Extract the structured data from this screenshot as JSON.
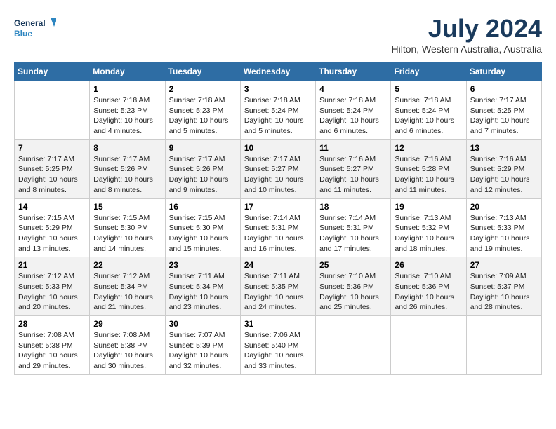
{
  "header": {
    "logo_line1": "General",
    "logo_line2": "Blue",
    "month": "July 2024",
    "location": "Hilton, Western Australia, Australia"
  },
  "days_of_week": [
    "Sunday",
    "Monday",
    "Tuesday",
    "Wednesday",
    "Thursday",
    "Friday",
    "Saturday"
  ],
  "weeks": [
    [
      {
        "day": "",
        "info": ""
      },
      {
        "day": "1",
        "info": "Sunrise: 7:18 AM\nSunset: 5:23 PM\nDaylight: 10 hours\nand 4 minutes."
      },
      {
        "day": "2",
        "info": "Sunrise: 7:18 AM\nSunset: 5:23 PM\nDaylight: 10 hours\nand 5 minutes."
      },
      {
        "day": "3",
        "info": "Sunrise: 7:18 AM\nSunset: 5:24 PM\nDaylight: 10 hours\nand 5 minutes."
      },
      {
        "day": "4",
        "info": "Sunrise: 7:18 AM\nSunset: 5:24 PM\nDaylight: 10 hours\nand 6 minutes."
      },
      {
        "day": "5",
        "info": "Sunrise: 7:18 AM\nSunset: 5:24 PM\nDaylight: 10 hours\nand 6 minutes."
      },
      {
        "day": "6",
        "info": "Sunrise: 7:17 AM\nSunset: 5:25 PM\nDaylight: 10 hours\nand 7 minutes."
      }
    ],
    [
      {
        "day": "7",
        "info": "Sunrise: 7:17 AM\nSunset: 5:25 PM\nDaylight: 10 hours\nand 8 minutes."
      },
      {
        "day": "8",
        "info": "Sunrise: 7:17 AM\nSunset: 5:26 PM\nDaylight: 10 hours\nand 8 minutes."
      },
      {
        "day": "9",
        "info": "Sunrise: 7:17 AM\nSunset: 5:26 PM\nDaylight: 10 hours\nand 9 minutes."
      },
      {
        "day": "10",
        "info": "Sunrise: 7:17 AM\nSunset: 5:27 PM\nDaylight: 10 hours\nand 10 minutes."
      },
      {
        "day": "11",
        "info": "Sunrise: 7:16 AM\nSunset: 5:27 PM\nDaylight: 10 hours\nand 11 minutes."
      },
      {
        "day": "12",
        "info": "Sunrise: 7:16 AM\nSunset: 5:28 PM\nDaylight: 10 hours\nand 11 minutes."
      },
      {
        "day": "13",
        "info": "Sunrise: 7:16 AM\nSunset: 5:29 PM\nDaylight: 10 hours\nand 12 minutes."
      }
    ],
    [
      {
        "day": "14",
        "info": "Sunrise: 7:15 AM\nSunset: 5:29 PM\nDaylight: 10 hours\nand 13 minutes."
      },
      {
        "day": "15",
        "info": "Sunrise: 7:15 AM\nSunset: 5:30 PM\nDaylight: 10 hours\nand 14 minutes."
      },
      {
        "day": "16",
        "info": "Sunrise: 7:15 AM\nSunset: 5:30 PM\nDaylight: 10 hours\nand 15 minutes."
      },
      {
        "day": "17",
        "info": "Sunrise: 7:14 AM\nSunset: 5:31 PM\nDaylight: 10 hours\nand 16 minutes."
      },
      {
        "day": "18",
        "info": "Sunrise: 7:14 AM\nSunset: 5:31 PM\nDaylight: 10 hours\nand 17 minutes."
      },
      {
        "day": "19",
        "info": "Sunrise: 7:13 AM\nSunset: 5:32 PM\nDaylight: 10 hours\nand 18 minutes."
      },
      {
        "day": "20",
        "info": "Sunrise: 7:13 AM\nSunset: 5:33 PM\nDaylight: 10 hours\nand 19 minutes."
      }
    ],
    [
      {
        "day": "21",
        "info": "Sunrise: 7:12 AM\nSunset: 5:33 PM\nDaylight: 10 hours\nand 20 minutes."
      },
      {
        "day": "22",
        "info": "Sunrise: 7:12 AM\nSunset: 5:34 PM\nDaylight: 10 hours\nand 21 minutes."
      },
      {
        "day": "23",
        "info": "Sunrise: 7:11 AM\nSunset: 5:34 PM\nDaylight: 10 hours\nand 23 minutes."
      },
      {
        "day": "24",
        "info": "Sunrise: 7:11 AM\nSunset: 5:35 PM\nDaylight: 10 hours\nand 24 minutes."
      },
      {
        "day": "25",
        "info": "Sunrise: 7:10 AM\nSunset: 5:36 PM\nDaylight: 10 hours\nand 25 minutes."
      },
      {
        "day": "26",
        "info": "Sunrise: 7:10 AM\nSunset: 5:36 PM\nDaylight: 10 hours\nand 26 minutes."
      },
      {
        "day": "27",
        "info": "Sunrise: 7:09 AM\nSunset: 5:37 PM\nDaylight: 10 hours\nand 28 minutes."
      }
    ],
    [
      {
        "day": "28",
        "info": "Sunrise: 7:08 AM\nSunset: 5:38 PM\nDaylight: 10 hours\nand 29 minutes."
      },
      {
        "day": "29",
        "info": "Sunrise: 7:08 AM\nSunset: 5:38 PM\nDaylight: 10 hours\nand 30 minutes."
      },
      {
        "day": "30",
        "info": "Sunrise: 7:07 AM\nSunset: 5:39 PM\nDaylight: 10 hours\nand 32 minutes."
      },
      {
        "day": "31",
        "info": "Sunrise: 7:06 AM\nSunset: 5:40 PM\nDaylight: 10 hours\nand 33 minutes."
      },
      {
        "day": "",
        "info": ""
      },
      {
        "day": "",
        "info": ""
      },
      {
        "day": "",
        "info": ""
      }
    ]
  ]
}
